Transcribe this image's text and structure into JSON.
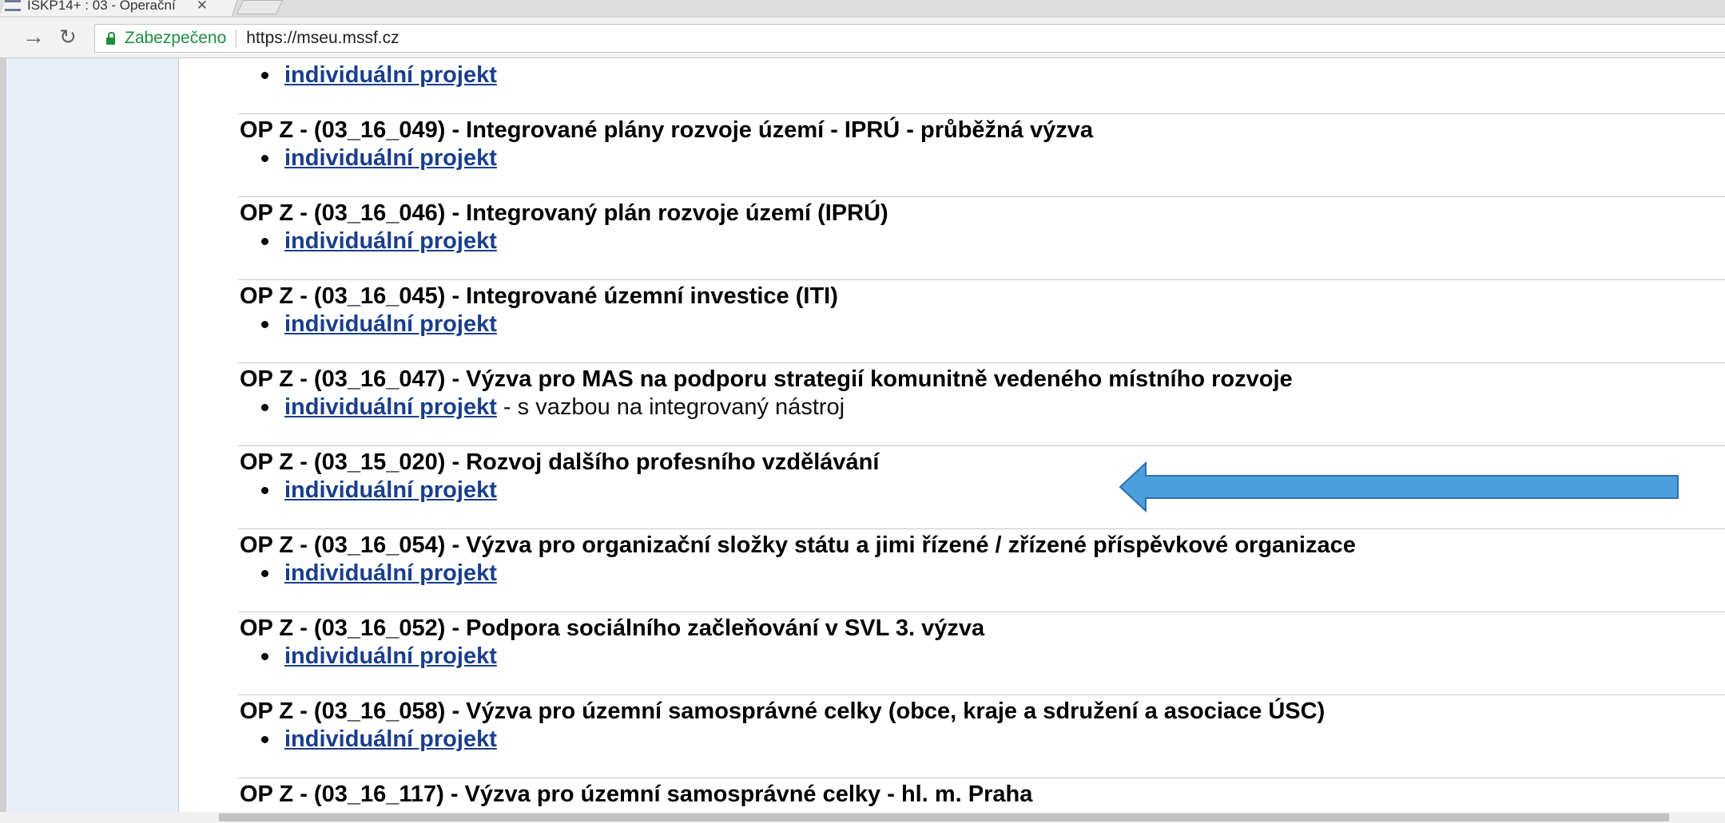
{
  "browser": {
    "tab_title": "ISKP14+ : 03 - Operační",
    "tab_close": "✕",
    "secure_label": "Zabezpečeno",
    "url": "https://mseu.mssf.cz"
  },
  "content": {
    "top_link": "individuální projekt",
    "calls": [
      {
        "title": "OP Z - (03_16_049) - Integrované plány rozvoje území - IPRÚ - průběžná výzva",
        "link": "individuální projekt",
        "suffix": ""
      },
      {
        "title": "OP Z - (03_16_046) - Integrovaný plán rozvoje území (IPRÚ)",
        "link": "individuální projekt",
        "suffix": ""
      },
      {
        "title": "OP Z - (03_16_045) - Integrované územní investice (ITI)",
        "link": "individuální projekt",
        "suffix": ""
      },
      {
        "title": "OP Z - (03_16_047) - Výzva pro MAS na podporu strategií komunitně vedeného místního rozvoje",
        "link": "individuální projekt",
        "suffix": " - s vazbou na integrovaný nástroj"
      },
      {
        "title": "OP Z - (03_15_020) - Rozvoj dalšího profesního vzdělávání",
        "link": "individuální projekt",
        "suffix": ""
      },
      {
        "title": "OP Z - (03_16_054) - Výzva pro organizační složky státu a jimi řízené / zřízené příspěvkové organizace",
        "link": "individuální projekt",
        "suffix": ""
      },
      {
        "title": "OP Z - (03_16_052) - Podpora sociálního začleňování v SVL 3. výzva",
        "link": "individuální projekt",
        "suffix": ""
      },
      {
        "title": "OP Z - (03_16_058) - Výzva pro územní samosprávné celky (obce, kraje a sdružení a asociace ÚSC)",
        "link": "individuální projekt",
        "suffix": ""
      },
      {
        "title": "OP Z - (03_16_117) - Výzva pro územní samosprávné celky - hl. m. Praha",
        "link": "",
        "suffix": ""
      }
    ]
  },
  "annotation": {
    "arrow_color": "#4a9fdc",
    "arrow_border": "#2d6fb0"
  }
}
